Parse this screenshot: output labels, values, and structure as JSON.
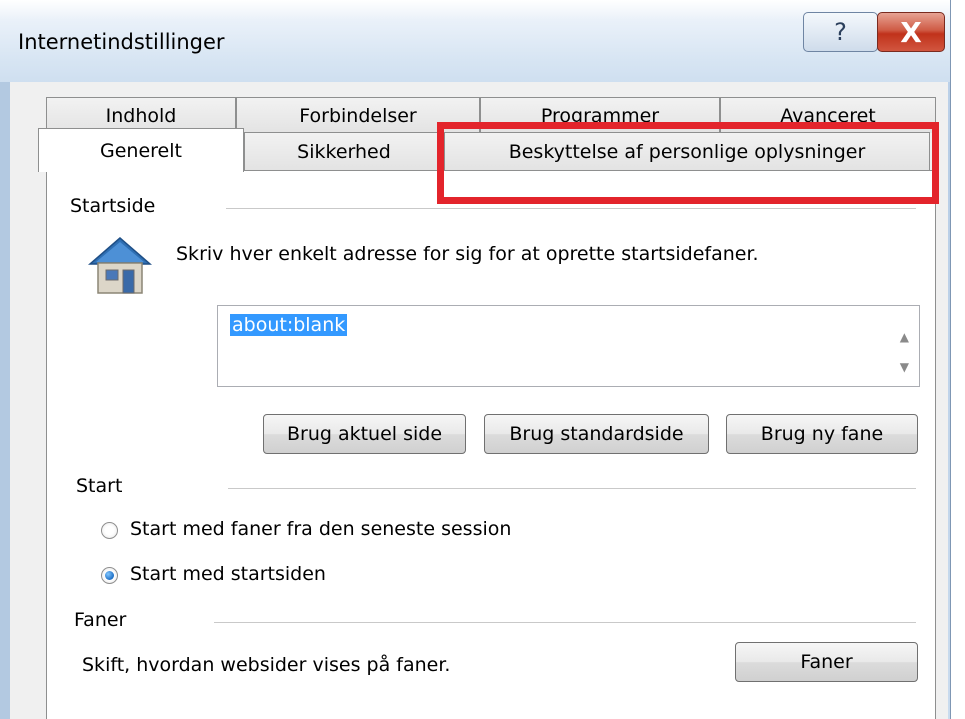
{
  "window": {
    "title": "Internetindstillinger"
  },
  "caption_buttons": {
    "help": "?",
    "close": "X"
  },
  "tabs": {
    "back_row": [
      {
        "label": "Indhold"
      },
      {
        "label": "Forbindelser"
      },
      {
        "label": "Programmer"
      },
      {
        "label": "Avanceret"
      }
    ],
    "front_row": [
      {
        "label": "Generelt"
      },
      {
        "label": "Sikkerhed"
      },
      {
        "label": "Beskyttelse af personlige oplysninger"
      }
    ],
    "selected": "Generelt"
  },
  "home_page": {
    "title": "Startside",
    "description": "Skriv hver enkelt adresse for sig for at oprette startsidefaner.",
    "address_value": "about:blank",
    "buttons": {
      "use_current": "Brug aktuel side",
      "use_default": "Brug standardside",
      "use_new_tab": "Brug ny fane"
    }
  },
  "startup": {
    "title": "Start",
    "options": [
      {
        "label": "Start med faner fra den seneste session",
        "checked": false
      },
      {
        "label": "Start med startsiden",
        "checked": true
      }
    ]
  },
  "tabs_section": {
    "title": "Faner",
    "description": "Skift, hvordan websider vises på faner.",
    "button": "Faner"
  },
  "colors": {
    "highlight": "#e3242b",
    "selection": "#3399ff"
  }
}
